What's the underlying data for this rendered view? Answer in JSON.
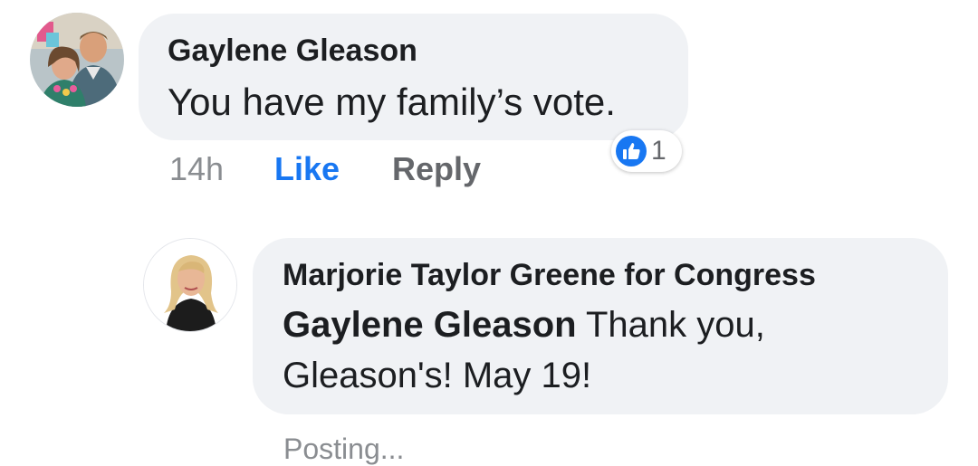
{
  "comment": {
    "author": "Gaylene Gleason",
    "text": "You have my family’s vote.",
    "time": "14h",
    "like_label": "Like",
    "reply_label": "Reply",
    "reaction_count": "1",
    "reaction_icon": "thumbs-up-icon"
  },
  "reply": {
    "author": "Marjorie Taylor Greene for Congress",
    "mention": "Gaylene Gleason",
    "text_line1": " Thank you,",
    "text_line2": "Gleason's! May 19!",
    "status": "Posting..."
  },
  "colors": {
    "bubble": "#f0f2f5",
    "accent": "#1877f2",
    "muted": "#65676b"
  }
}
